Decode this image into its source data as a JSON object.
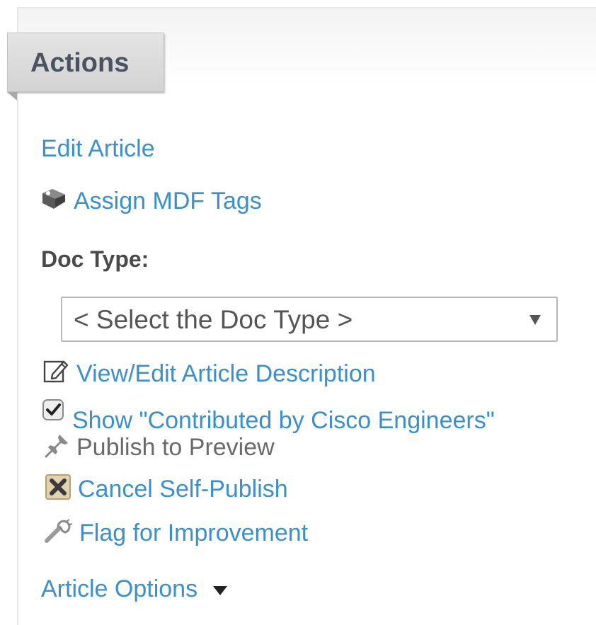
{
  "panel": {
    "tab_label": "Actions"
  },
  "actions": {
    "edit_article": "Edit Article",
    "assign_mdf_tags": "Assign MDF Tags",
    "doc_type_label": "Doc Type:",
    "doc_type_select": {
      "selected": "< Select the Doc Type >"
    },
    "view_edit_description": "View/Edit Article Description",
    "show_contributed": "Show \"Contributed by Cisco Engineers\"",
    "publish_to_preview": "Publish to Preview",
    "cancel_self_publish": "Cancel Self-Publish",
    "flag_for_improvement": "Flag for Improvement",
    "article_options": "Article Options"
  },
  "icons": {
    "assign_mdf_tags": "tag-icon",
    "view_edit_description": "edit-icon",
    "show_contributed": "checkbox-checked-icon",
    "publish_to_preview": "pin-icon",
    "cancel_self_publish": "cancel-x-icon",
    "flag_for_improvement": "wrench-icon",
    "article_options": "caret-down-icon"
  },
  "colors": {
    "link": "#3a8fd0",
    "tab_text": "#4a5460",
    "label_text": "#4a4a4a",
    "disabled_text": "#6a6a6a"
  }
}
